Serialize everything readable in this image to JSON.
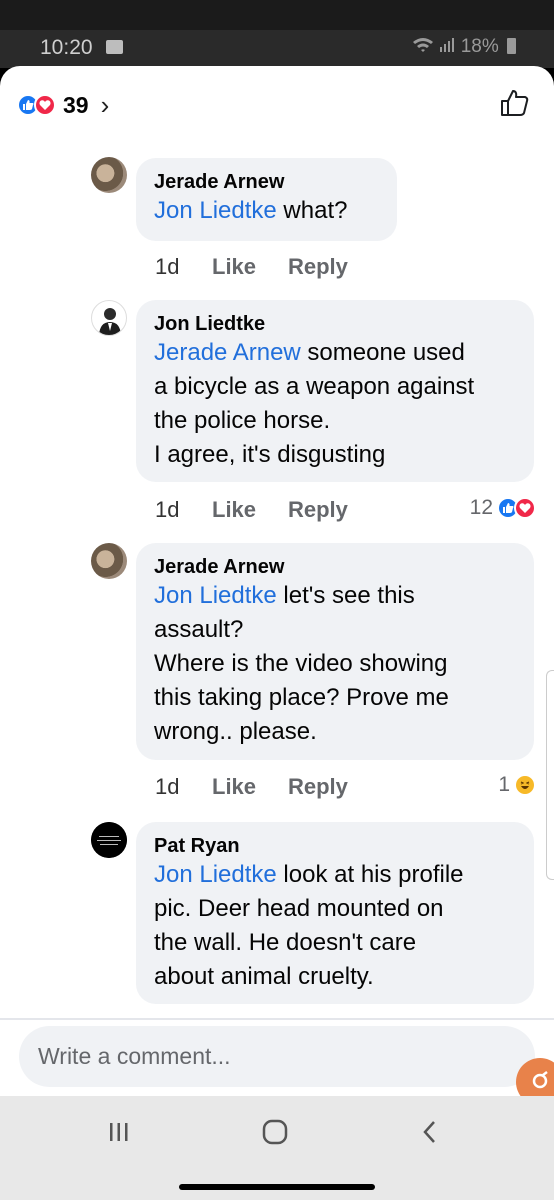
{
  "status_bar": {
    "time": "10:20",
    "battery_text": "18%"
  },
  "header": {
    "reaction_count": "39",
    "chevron": "›"
  },
  "comments": [
    {
      "author": "Jerade Arnew",
      "mention": "Jon Liedtke",
      "lines": [
        " what?"
      ],
      "time": "1d",
      "like": "Like",
      "reply": "Reply"
    },
    {
      "author": "Jon Liedtke",
      "mention": "Jerade Arnew",
      "lines": [
        " someone used",
        "a bicycle as a weapon against",
        "the police horse.",
        "I agree, it's disgusting"
      ],
      "time": "1d",
      "like": "Like",
      "reply": "Reply",
      "reaction_count": "12"
    },
    {
      "author": "Jerade Arnew",
      "mention": "Jon Liedtke",
      "lines": [
        " let's see this",
        "assault?",
        "Where is the video showing",
        "this taking place? Prove me",
        "wrong.. please."
      ],
      "time": "1d",
      "like": "Like",
      "reply": "Reply",
      "reaction_count": "1"
    },
    {
      "author": "Pat Ryan",
      "mention": "Jon Liedtke",
      "lines": [
        " look at his profile",
        "pic. Deer head mounted on",
        "the wall. He doesn't care",
        "about animal cruelty."
      ]
    }
  ],
  "composer": {
    "placeholder": "Write a comment..."
  },
  "nav": {
    "recents": "|||",
    "home": "○",
    "back": "<"
  },
  "colors": {
    "mention_blue": "#216fdb",
    "like_blue": "#1877f2",
    "love_red": "#f02849",
    "haha_yellow": "#f7b928",
    "bubble_bg": "#f0f2f5"
  }
}
